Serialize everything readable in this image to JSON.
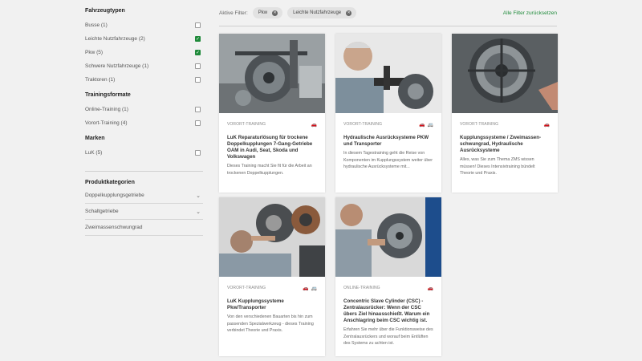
{
  "sidebar": {
    "vehicle_types": {
      "title": "Fahrzeugtypen",
      "items": [
        {
          "label": "Busse (1)",
          "checked": false
        },
        {
          "label": "Leichte Nutzfahrzeuge (2)",
          "checked": true
        },
        {
          "label": "Pkw (5)",
          "checked": true
        },
        {
          "label": "Schwere Nutzfahrzeuge (1)",
          "checked": false
        },
        {
          "label": "Traktoren (1)",
          "checked": false
        }
      ]
    },
    "formats": {
      "title": "Trainingsformate",
      "items": [
        {
          "label": "Online-Training (1)",
          "checked": false
        },
        {
          "label": "Vorort-Training (4)",
          "checked": false
        }
      ]
    },
    "brands": {
      "title": "Marken",
      "items": [
        {
          "label": "LuK (5)",
          "checked": false
        }
      ]
    },
    "categories": {
      "title": "Produktkategorien",
      "items": [
        {
          "label": "Doppelkupplungsgetriebe",
          "expandable": true
        },
        {
          "label": "Schaltgetriebe",
          "expandable": true
        },
        {
          "label": "Zweimassenschwungrad",
          "expandable": false
        }
      ]
    }
  },
  "filters": {
    "label": "Aktive Filter:",
    "chips": [
      "Pkw",
      "Leichte Nutzfahrzeuge"
    ],
    "reset_label": "Alle Filter zurücksetzen"
  },
  "cards": [
    {
      "type": "VORORT-TRAINING",
      "icons": [
        "car-icon"
      ],
      "title": "LuK Reparaturlösung für trockene Doppelkupplungen 7-Gang-Getriebe OAM in Audi, Seat, Skoda und Volkswagen",
      "desc": "Dieses Training macht Sie fit für die Arbeit an trockenen Doppelkupplungen."
    },
    {
      "type": "VORORT-TRAINING",
      "icons": [
        "car-icon",
        "van-icon"
      ],
      "title": "Hydraulische Ausrücksysteme PKW und Transporter",
      "desc": "In diesem Tagestraining geht die Reise von Komponenten im Kupplungssystem weiter über hydraulische Ausrücksysteme mit..."
    },
    {
      "type": "VORORT-TRAINING",
      "icons": [
        "car-icon"
      ],
      "title": "Kupplungssysteme / Zweimassen­schwungrad, Hydraulische Ausrücksysteme",
      "desc": "Alles, was Sie zum Thema ZMS wissen müssen! Dieses Intensivtraining bündelt Theorie und Praxis."
    },
    {
      "type": "VORORT-TRAINING",
      "icons": [
        "car-icon",
        "van-icon"
      ],
      "title": "LuK Kupplungssysteme Pkw/Transporter",
      "desc": "Von den verschiedenen Bauarten bis hin zum passenden Spezialwerkzeug - dieses Training verbindet Theorie und Praxis."
    },
    {
      "type": "ONLINE-TRAINING",
      "icons": [
        "car-icon"
      ],
      "title": "Concentric Slave Cylinder (CSC) - Zen­tralausrücker: Wenn der CSC übers Ziel hinausschießt. Warum ein An­schlagring beim CSC wichtig ist.",
      "desc": "Erfahren Sie mehr über die Funktionsweise des Zentralausrückers und worauf beim Entlüften des Systems zu achten ist."
    }
  ],
  "colors": {
    "accent": "#1f8a3a",
    "background": "#f1f1f1"
  }
}
